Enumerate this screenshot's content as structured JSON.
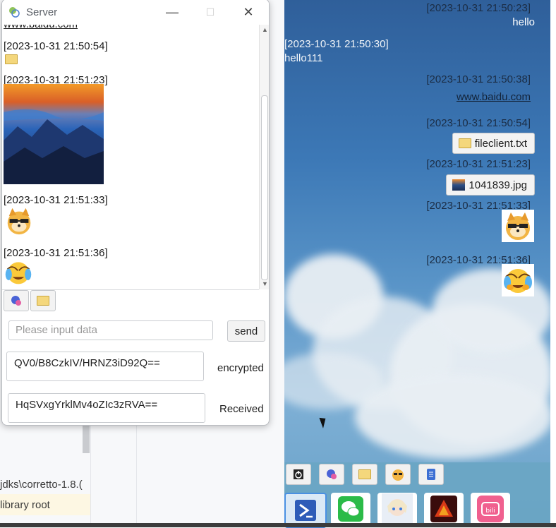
{
  "ide": {
    "path_text": "jdks\\corretto-1.8.(",
    "library_text": "library root"
  },
  "server": {
    "title": "Server",
    "minimize_glyph": "—",
    "maximize_glyph": "☐",
    "close_glyph": "✕",
    "messages": [
      {
        "text": "www.baidu.com"
      },
      {
        "timestamp": "[2023-10-31 21:50:54]"
      },
      {
        "timestamp": "[2023-10-31 21:51:23]"
      },
      {
        "timestamp": "[2023-10-31 21:51:33]"
      },
      {
        "timestamp": "[2023-10-31 21:51:36]"
      }
    ],
    "input_placeholder": "Please input data",
    "send_label": "send",
    "encrypted_value": "QV0/B8CzkIV/HRNZ3iD92Q==",
    "encrypted_label": "encrypted",
    "received_value": "HqSVxgYrklMv4oZIc3zRVA==",
    "received_label": "Received"
  },
  "client": {
    "messages": [
      {
        "timestamp": "[2023-10-31 21:50:23]",
        "text": "hello",
        "side": "right"
      },
      {
        "timestamp": "[2023-10-31 21:50:30]",
        "text": "hello111",
        "side": "left"
      },
      {
        "timestamp": "[2023-10-31 21:50:38]",
        "text": "www.baidu.com",
        "side": "right"
      },
      {
        "timestamp": "[2023-10-31 21:50:54]",
        "file": "fileclient.txt",
        "side": "right"
      },
      {
        "timestamp": "[2023-10-31 21:51:23]",
        "file": "1041839.jpg",
        "side": "right"
      },
      {
        "timestamp": "[2023-10-31 21:51:33]",
        "side": "right"
      },
      {
        "timestamp": "[2023-10-31 21:51:36]",
        "side": "right"
      }
    ]
  },
  "icons": [
    "power-icon",
    "emoji-picker-icon",
    "folder-icon",
    "doge-icon",
    "notes-icon",
    "powershell-icon",
    "wechat-icon",
    "anime-app-icon",
    "game-app-icon",
    "bilibili-icon"
  ]
}
